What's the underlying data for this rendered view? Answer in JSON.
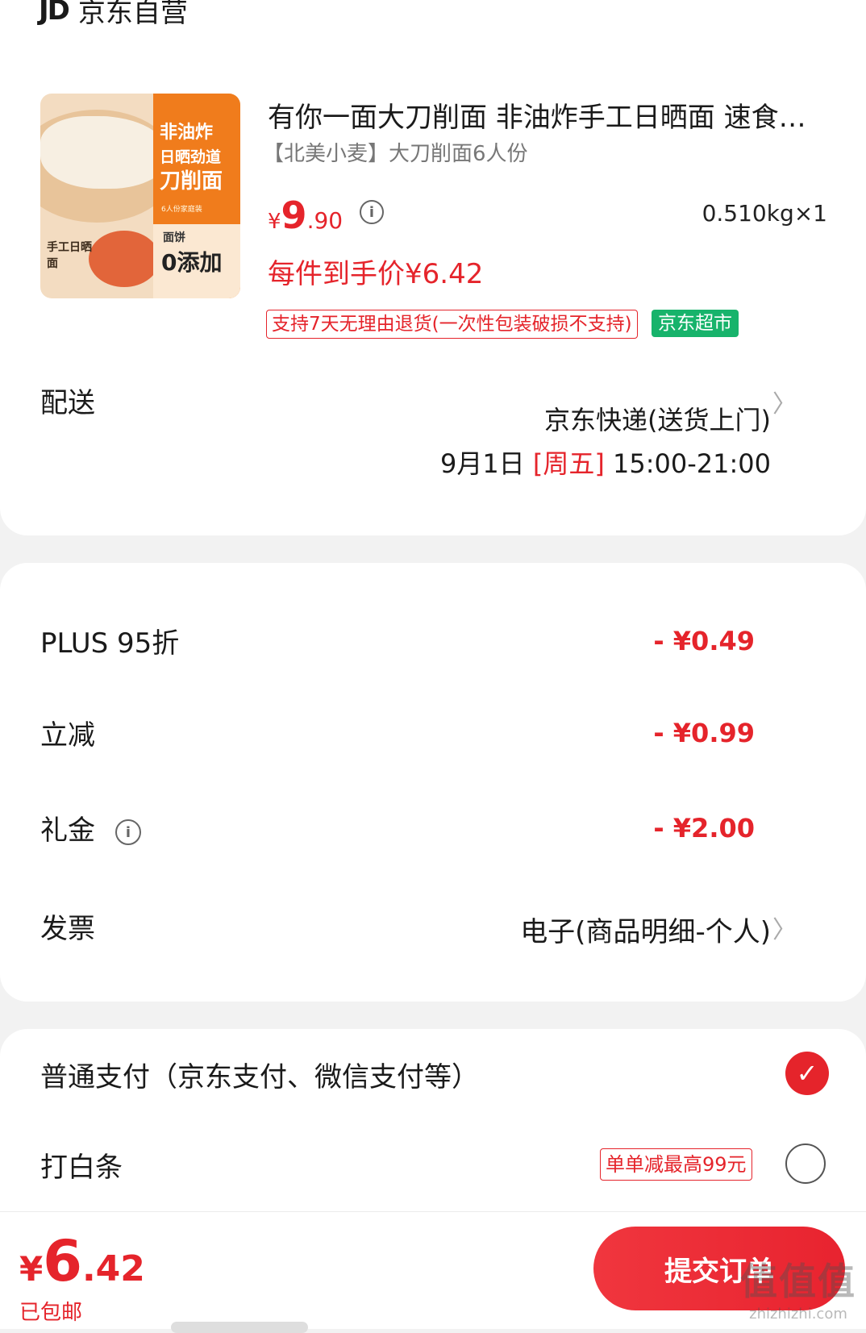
{
  "store": {
    "logo": "JD",
    "name": "京东自营"
  },
  "product": {
    "title": "有你一面大刀削面 非油炸手工日晒面 速食面饼",
    "spec": "【北美小麦】大刀削面6人份",
    "price_currency": "¥",
    "price_int": "9",
    "price_dec": ".90",
    "quantity": "0.510kg×1",
    "unit_price": "每件到手价¥6.42",
    "tags": {
      "return": "支持7天无理由退货(一次性包装破损不支持)",
      "channel": "京东超市"
    },
    "image": {
      "line1": "非油炸",
      "line2": "日晒劲道",
      "line3": "刀削面",
      "small": "6人份家庭装",
      "badge_top": "面饼",
      "badge_main": "0添加",
      "pack_text": "手工日晒面"
    }
  },
  "delivery": {
    "label": "配送",
    "method": "京东快递(送货上门)",
    "date": "9月1日",
    "weekday": "[周五]",
    "time": "15:00-21:00"
  },
  "discounts": [
    {
      "label": "PLUS 95折",
      "value": "- ¥0.49"
    },
    {
      "label": "立减",
      "value": "- ¥0.99"
    },
    {
      "label": "礼金",
      "value": "- ¥2.00"
    }
  ],
  "invoice": {
    "label": "发票",
    "value": "电子(商品明细-个人)"
  },
  "payment": {
    "normal": "普通支付（京东支付、微信支付等）",
    "baitiao": "打白条",
    "baitiao_tag": "单单减最高99元"
  },
  "footer": {
    "total_currency": "¥",
    "total_int": "6",
    "total_dec": ".42",
    "shipping": "已包邮",
    "submit": "提交订单",
    "watermark": "值值值",
    "watermark_url": "zhizhizhi.com"
  },
  "colors": {
    "accent": "#e5242b",
    "channel_green": "#17b36b",
    "thumb_orange": "#f07c1c"
  }
}
